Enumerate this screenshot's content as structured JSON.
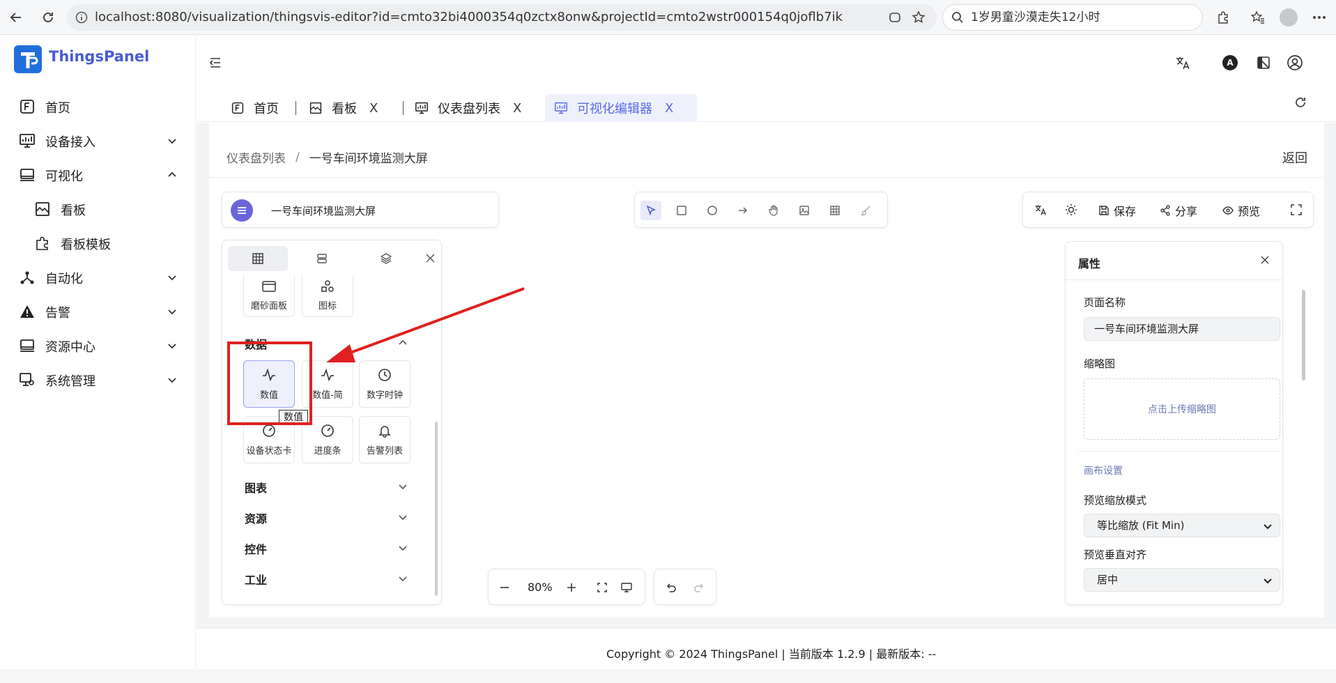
{
  "browser": {
    "url": "localhost:8080/visualization/thingsvis-editor?id=cmto32bi4000354q0zctx8onw&projectId=cmto2wstr000154q0joflb7ik",
    "search_text": "1岁男童沙漠走失12小时"
  },
  "app": {
    "name": "ThingsPanel"
  },
  "sidebar": {
    "items": [
      {
        "label": "首页"
      },
      {
        "label": "设备接入"
      },
      {
        "label": "可视化"
      },
      {
        "label": "看板"
      },
      {
        "label": "看板模板"
      },
      {
        "label": "自动化"
      },
      {
        "label": "告警"
      },
      {
        "label": "资源中心"
      },
      {
        "label": "系统管理"
      }
    ]
  },
  "tabs": [
    {
      "label": "首页"
    },
    {
      "label": "看板",
      "close": "X"
    },
    {
      "label": "仪表盘列表",
      "close": "X"
    },
    {
      "label": "可视化编辑器",
      "close": "X"
    }
  ],
  "breadcrumb": {
    "parent": "仪表盘列表",
    "separator": "/",
    "current": "一号车间环境监测大屏"
  },
  "back_label": "返回",
  "editor": {
    "title": "一号车间环境监测大屏",
    "actions": {
      "save": "保存",
      "share": "分享",
      "preview": "预览"
    }
  },
  "components": {
    "top_items": [
      {
        "label": "磨砂面板"
      },
      {
        "label": "图标"
      }
    ],
    "data_section": "数据",
    "data_items": [
      {
        "label": "数值"
      },
      {
        "label": "数值-简"
      },
      {
        "label": "数字时钟"
      },
      {
        "label": "设备状态卡"
      },
      {
        "label": "进度条"
      },
      {
        "label": "告警列表"
      }
    ],
    "tooltip": "数值",
    "sections": [
      {
        "label": "图表"
      },
      {
        "label": "资源"
      },
      {
        "label": "控件"
      },
      {
        "label": "工业"
      }
    ]
  },
  "properties": {
    "title": "属性",
    "page_name_label": "页面名称",
    "page_name_value": "一号车间环境监测大屏",
    "thumbnail_label": "缩略图",
    "upload_text": "点击上传缩略图",
    "canvas_settings": "画布设置",
    "preview_scale_label": "预览缩放模式",
    "preview_scale_value": "等比缩放 (Fit Min)",
    "preview_valign_label": "预览垂直对齐",
    "preview_valign_value": "居中"
  },
  "zoom": {
    "value": "80%"
  },
  "footer": {
    "copyright": "Copyright © 2024 ThingsPanel  |  当前版本 1.2.9  |  最新版本: --"
  },
  "colors": {
    "accent": "#4a5bd6",
    "annotation": "#e02020",
    "logo_bg": "#1f6fdb"
  }
}
